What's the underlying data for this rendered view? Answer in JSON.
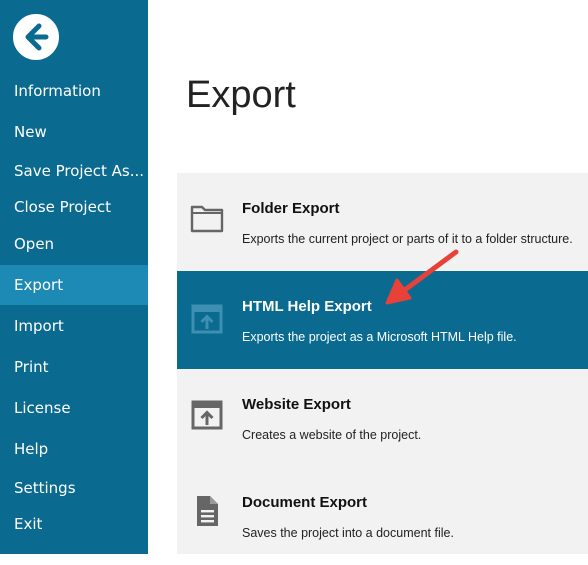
{
  "colors": {
    "sidebar_bg": "#0a6a8f",
    "sidebar_active_bg": "#1d8ab6",
    "selected_option_bg": "#0a6a8f",
    "panel_bg": "#f2f2f2",
    "annotation_arrow": "#e8413a"
  },
  "sidebar": {
    "back_icon": "back-arrow-icon",
    "items": [
      {
        "label": "Information"
      },
      {
        "label": "New"
      },
      {
        "label": "Save Project As..."
      },
      {
        "label": "Close Project"
      },
      {
        "label": "Open"
      },
      {
        "label": "Export",
        "active": true
      },
      {
        "label": "Import"
      },
      {
        "label": "Print"
      },
      {
        "label": "License"
      },
      {
        "label": "Help"
      },
      {
        "label": "Settings"
      },
      {
        "label": "Exit"
      }
    ]
  },
  "main": {
    "title": "Export",
    "options": [
      {
        "icon": "folder-icon",
        "title": "Folder Export",
        "description": "Exports the current project or parts of it to a folder structure."
      },
      {
        "icon": "export-window-icon",
        "title": "HTML Help Export",
        "description": "Exports the project as a Microsoft HTML Help file.",
        "selected": true
      },
      {
        "icon": "export-window-icon",
        "title": "Website Export",
        "description": "Creates a website of the project."
      },
      {
        "icon": "document-icon",
        "title": "Document Export",
        "description": "Saves the project into a document file."
      }
    ]
  }
}
